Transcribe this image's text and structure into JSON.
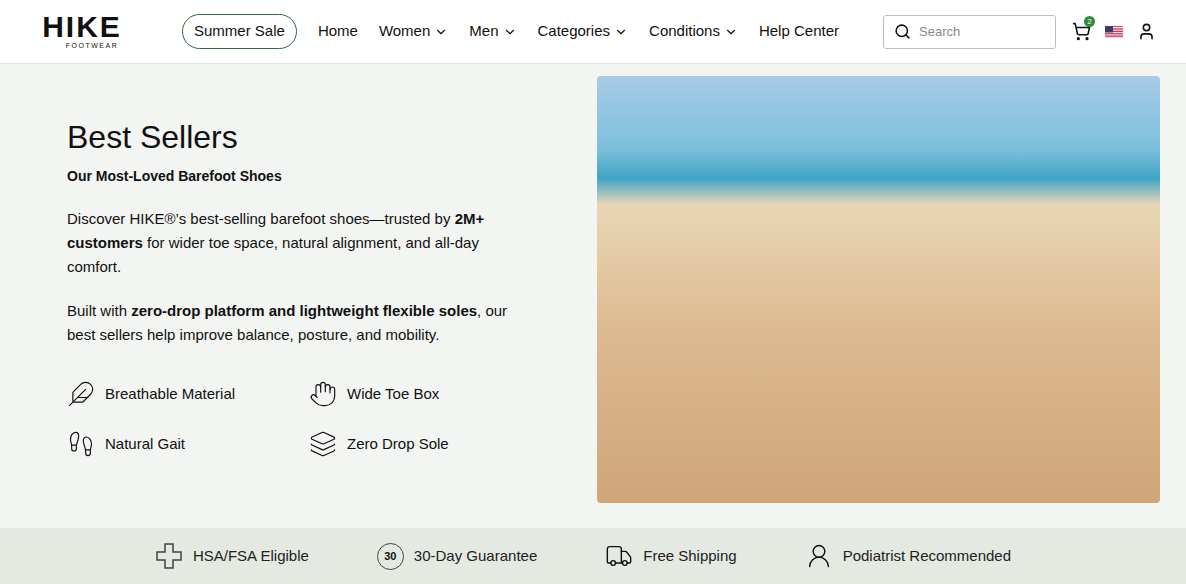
{
  "header": {
    "logo": {
      "name": "HIKE",
      "sub": "FOOTWEAR"
    },
    "nav": [
      {
        "label": "Summer Sale",
        "kind": "pill",
        "dropdown": false
      },
      {
        "label": "Home",
        "kind": "link",
        "dropdown": false
      },
      {
        "label": "Women",
        "kind": "link",
        "dropdown": true
      },
      {
        "label": "Men",
        "kind": "link",
        "dropdown": true
      },
      {
        "label": "Categories",
        "kind": "link",
        "dropdown": true
      },
      {
        "label": "Conditions",
        "kind": "link",
        "dropdown": true
      },
      {
        "label": "Help Center",
        "kind": "link",
        "dropdown": false
      }
    ],
    "search": {
      "placeholder": "Search"
    },
    "cart": {
      "count": "2"
    }
  },
  "hero": {
    "title": "Best Sellers",
    "subtitle": "Our Most-Loved Barefoot Shoes",
    "paragraphs": [
      [
        {
          "text": "Discover HIKE®’s best-selling barefoot shoes—trusted by ",
          "bold": false
        },
        {
          "text": "2M+ customers",
          "bold": true
        },
        {
          "text": " for wider toe space, natural alignment, and all-day comfort.",
          "bold": false
        }
      ],
      [
        {
          "text": "Built with ",
          "bold": false
        },
        {
          "text": "zero-drop platform and lightweight flexible soles",
          "bold": true
        },
        {
          "text": ", our best sellers help improve balance, posture, and mobility.",
          "bold": false
        }
      ]
    ],
    "features": [
      {
        "label": "Breathable Material"
      },
      {
        "label": "Wide Toe Box"
      },
      {
        "label": "Natural Gait"
      },
      {
        "label": "Zero Drop Sole"
      }
    ]
  },
  "badges": [
    {
      "label": "HSA/FSA Eligible",
      "icon_text": ""
    },
    {
      "label": "30-Day Guarantee",
      "icon_text": "30"
    },
    {
      "label": "Free Shipping",
      "icon_text": ""
    },
    {
      "label": "Podiatrist Recommended",
      "icon_text": ""
    }
  ]
}
